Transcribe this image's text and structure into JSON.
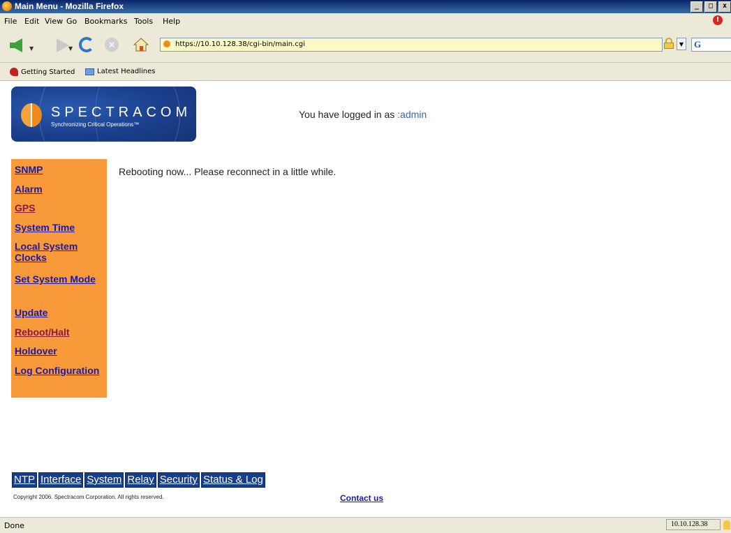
{
  "window": {
    "title": "Main Menu - Mozilla Firefox",
    "buttons": [
      "_",
      "□",
      "x"
    ]
  },
  "menubar": {
    "items": [
      "File",
      "Edit",
      "View",
      "Go",
      "Bookmarks",
      "Tools",
      "Help"
    ]
  },
  "toolbar": {
    "url": "https://10.10.128.38/cgi-bin/main.cgi",
    "search_logo": "G"
  },
  "bookmarks": {
    "items": [
      "Getting Started",
      "Latest Headlines"
    ]
  },
  "page": {
    "logo": {
      "brand": "SPECTRACOM",
      "tagline": "Synchronizing Critical Operations™"
    },
    "login_prefix": "You have logged in as ",
    "login_user": ":admin",
    "sidebar": [
      {
        "label": "SNMP",
        "visited": false
      },
      {
        "label": "Alarm",
        "visited": false
      },
      {
        "label": "GPS",
        "visited": true
      },
      {
        "label": "System Time",
        "visited": false
      },
      {
        "label": "Local System Clocks",
        "visited": false
      },
      {
        "label": "Set System Mode",
        "visited": false
      },
      {
        "label": "Update",
        "visited": false
      },
      {
        "label": "Reboot/Halt",
        "visited": true
      },
      {
        "label": "Holdover",
        "visited": false
      },
      {
        "label": "Log Configuration",
        "visited": false
      }
    ],
    "message": "Rebooting now... Please reconnect in a little while.",
    "bottom_tabs": [
      "NTP",
      "Interface",
      "System",
      "Relay",
      "Security",
      "Status & Log"
    ],
    "copyright": "Copyright 2006. Spectracom Corporation. All rights reserved.",
    "contact": "Contact us"
  },
  "statusbar": {
    "status": "Done",
    "host": "10.10.128.38"
  },
  "colors": {
    "sidebar_bg": "#f8993a",
    "link": "#1a1aa8",
    "visited_link": "#8b1a3d",
    "tab_bg": "#173e8c",
    "logo_bg": "#1b3f8c"
  }
}
